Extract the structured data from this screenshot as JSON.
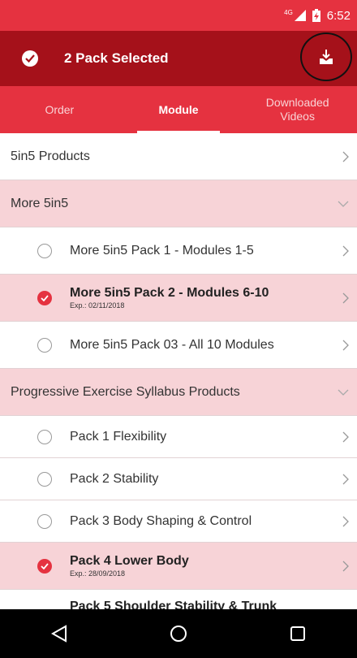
{
  "status": {
    "network": "4G",
    "time": "6:52"
  },
  "header": {
    "title": "2 Pack Selected",
    "download_icon": "download-icon"
  },
  "tabs": [
    {
      "label": "Order",
      "active": false
    },
    {
      "label": "Module",
      "active": true
    },
    {
      "label": "Downloaded Videos",
      "active": false
    }
  ],
  "list": {
    "section1": {
      "label": "5in5 Products"
    },
    "section2": {
      "label": "More 5in5"
    },
    "more5in5": [
      {
        "label": "More 5in5 Pack 1 - Modules 1-5",
        "selected": false
      },
      {
        "label": "More 5in5 Pack 2 - Modules 6-10",
        "selected": true,
        "exp": "Exp.: 02/11/2018"
      },
      {
        "label": "More 5in5 Pack 03 - All 10 Modules",
        "selected": false
      }
    ],
    "section3": {
      "label": "Progressive Exercise Syllabus Products"
    },
    "pes": [
      {
        "label": "Pack 1 Flexibility",
        "selected": false
      },
      {
        "label": "Pack 2 Stability",
        "selected": false
      },
      {
        "label": "Pack 3 Body Shaping & Control",
        "selected": false
      },
      {
        "label": "Pack 4 Lower Body",
        "selected": true,
        "exp": "Exp.: 28/09/2018"
      },
      {
        "label": "Pack 5 Shoulder Stability & Trunk",
        "selected": false
      }
    ]
  },
  "colors": {
    "primary": "#e53240",
    "dark": "#a5111a",
    "highlight": "#f7d3d7"
  }
}
